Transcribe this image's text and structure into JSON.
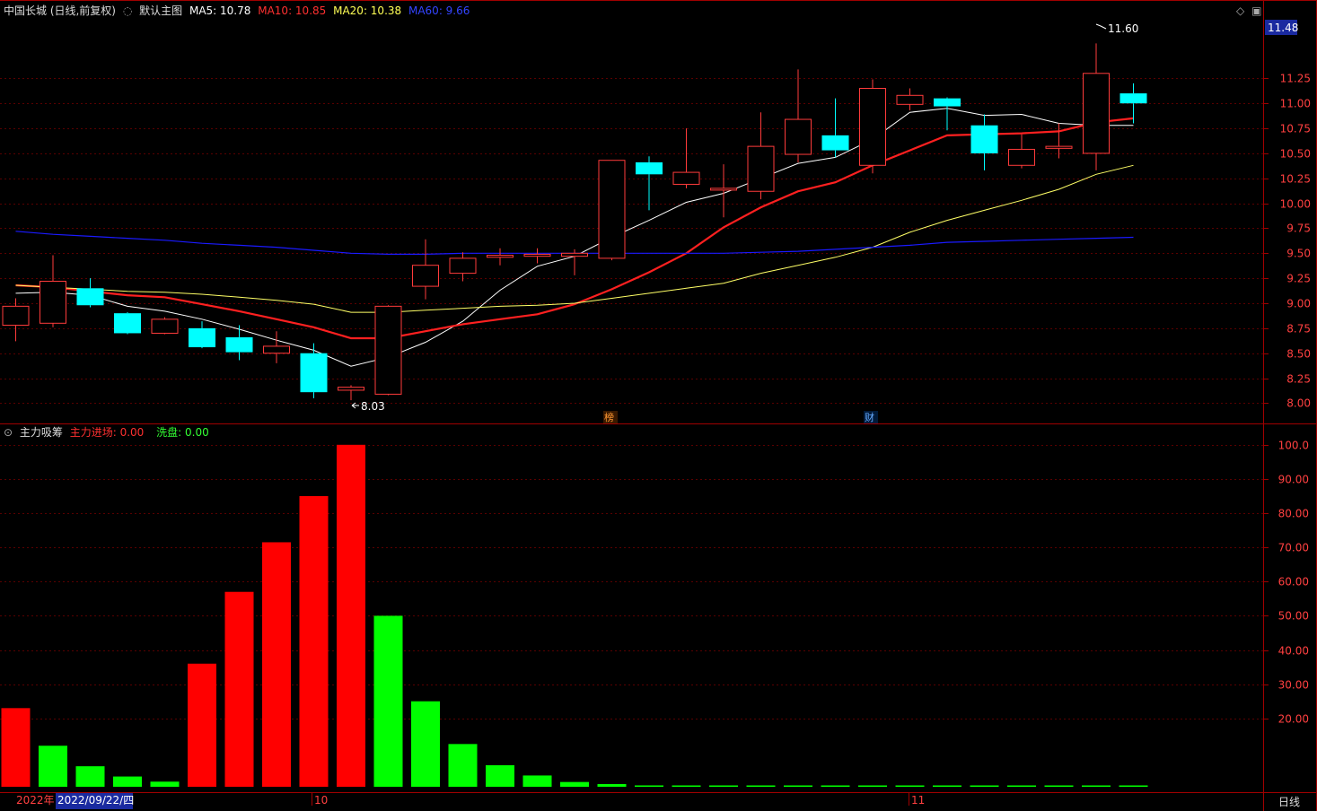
{
  "header": {
    "stock_label": "中国长城 (日线,前复权)",
    "template_label": "默认主图",
    "ma5": "MA5: 10.78",
    "ma10": "MA10: 10.85",
    "ma20": "MA20: 10.38",
    "ma60": "MA60: 9.66"
  },
  "sub_header": {
    "indicator_name": "主力吸筹",
    "in_label": "主力进场: 0.00",
    "wash_label": "洗盘: 0.00"
  },
  "colors": {
    "up": "#ff3b3b",
    "down": "#00ffff",
    "ma5": "#ffffff",
    "ma10": "#ff2020",
    "ma20": "#ffff66",
    "ma60": "#1a1aff",
    "bar_red": "#ff0000",
    "bar_green": "#00ff00",
    "axis": "#a00000"
  },
  "annotations": {
    "low_label": "8.03",
    "high_label": "11.60",
    "current_price": "11.48",
    "marker_bang": "榜",
    "marker_cai": "财"
  },
  "footer": {
    "year_label": "2022年",
    "date_label": "2022/09/22/四",
    "month_oct": "10",
    "month_nov": "11",
    "period_label": "日线"
  },
  "chart_data": [
    {
      "type": "candlestick",
      "y_ticks": [
        "11.25",
        "11.00",
        "10.75",
        "10.50",
        "10.25",
        "10.00",
        "9.75",
        "9.50",
        "9.25",
        "9.00",
        "8.75",
        "8.50",
        "8.25",
        "8.00"
      ],
      "ylim": [
        7.95,
        11.72
      ],
      "candles": [
        {
          "o": 8.78,
          "c": 8.97,
          "h": 9.05,
          "l": 8.62
        },
        {
          "o": 8.8,
          "c": 9.22,
          "h": 9.48,
          "l": 8.76
        },
        {
          "o": 9.15,
          "c": 8.98,
          "h": 9.25,
          "l": 8.96
        },
        {
          "o": 8.9,
          "c": 8.7,
          "h": 8.91,
          "l": 8.69
        },
        {
          "o": 8.7,
          "c": 8.84,
          "h": 8.86,
          "l": 8.69
        },
        {
          "o": 8.75,
          "c": 8.56,
          "h": 8.82,
          "l": 8.55
        },
        {
          "o": 8.66,
          "c": 8.51,
          "h": 8.78,
          "l": 8.43
        },
        {
          "o": 8.5,
          "c": 8.57,
          "h": 8.72,
          "l": 8.4
        },
        {
          "o": 8.5,
          "c": 8.11,
          "h": 8.6,
          "l": 8.05
        },
        {
          "o": 8.13,
          "c": 8.16,
          "h": 8.18,
          "l": 8.03
        },
        {
          "o": 8.09,
          "c": 8.97,
          "h": 8.98,
          "l": 8.08
        },
        {
          "o": 9.17,
          "c": 9.38,
          "h": 9.64,
          "l": 9.04
        },
        {
          "o": 9.3,
          "c": 9.45,
          "h": 9.51,
          "l": 9.22
        },
        {
          "o": 9.46,
          "c": 9.48,
          "h": 9.55,
          "l": 9.38
        },
        {
          "o": 9.47,
          "c": 9.49,
          "h": 9.55,
          "l": 9.4
        },
        {
          "o": 9.47,
          "c": 9.5,
          "h": 9.54,
          "l": 9.28
        },
        {
          "o": 9.45,
          "c": 10.43,
          "h": 10.43,
          "l": 9.43
        },
        {
          "o": 10.41,
          "c": 10.29,
          "h": 10.47,
          "l": 9.93
        },
        {
          "o": 10.19,
          "c": 10.31,
          "h": 10.75,
          "l": 10.15
        },
        {
          "o": 10.14,
          "c": 10.15,
          "h": 10.39,
          "l": 9.86
        },
        {
          "o": 10.12,
          "c": 10.57,
          "h": 10.91,
          "l": 10.04
        },
        {
          "o": 10.49,
          "c": 10.84,
          "h": 11.34,
          "l": 10.41
        },
        {
          "o": 10.68,
          "c": 10.53,
          "h": 11.05,
          "l": 10.46
        },
        {
          "o": 10.38,
          "c": 11.15,
          "h": 11.24,
          "l": 10.3
        },
        {
          "o": 10.99,
          "c": 11.08,
          "h": 11.15,
          "l": 10.93
        },
        {
          "o": 11.05,
          "c": 10.97,
          "h": 11.06,
          "l": 10.73
        },
        {
          "o": 10.78,
          "c": 10.5,
          "h": 10.89,
          "l": 10.33
        },
        {
          "o": 10.38,
          "c": 10.54,
          "h": 10.69,
          "l": 10.35
        },
        {
          "o": 10.55,
          "c": 10.57,
          "h": 10.8,
          "l": 10.45
        },
        {
          "o": 10.5,
          "c": 11.3,
          "h": 11.6,
          "l": 10.33
        },
        {
          "o": 11.1,
          "c": 11.0,
          "h": 11.2,
          "l": 10.8
        }
      ],
      "series": [
        {
          "name": "MA5",
          "values": [
            9.1,
            9.11,
            9.08,
            8.97,
            8.92,
            8.84,
            8.74,
            8.63,
            8.53,
            8.37,
            8.46,
            8.61,
            8.82,
            9.13,
            9.37,
            9.47,
            9.66,
            9.83,
            10.01,
            10.1,
            10.25,
            10.4,
            10.46,
            10.64,
            10.91,
            10.95,
            10.88,
            10.89,
            10.8,
            10.78,
            10.78
          ]
        },
        {
          "name": "MA10",
          "values": [
            9.18,
            9.16,
            9.12,
            9.08,
            9.06,
            8.99,
            8.92,
            8.84,
            8.76,
            8.65,
            8.65,
            8.72,
            8.79,
            8.84,
            8.89,
            8.99,
            9.14,
            9.31,
            9.5,
            9.76,
            9.96,
            10.12,
            10.21,
            10.38,
            10.53,
            10.68,
            10.69,
            10.7,
            10.72,
            10.81,
            10.85
          ]
        },
        {
          "name": "MA20",
          "values": [
            9.18,
            9.16,
            9.14,
            9.12,
            9.11,
            9.09,
            9.06,
            9.03,
            8.99,
            8.91,
            8.91,
            8.93,
            8.95,
            8.97,
            8.98,
            9.0,
            9.05,
            9.1,
            9.15,
            9.2,
            9.3,
            9.38,
            9.46,
            9.56,
            9.71,
            9.83,
            9.93,
            10.03,
            10.14,
            10.29,
            10.38
          ]
        },
        {
          "name": "MA60",
          "values": [
            9.72,
            9.69,
            9.67,
            9.65,
            9.63,
            9.6,
            9.58,
            9.56,
            9.53,
            9.5,
            9.49,
            9.49,
            9.5,
            9.5,
            9.5,
            9.5,
            9.5,
            9.5,
            9.5,
            9.5,
            9.51,
            9.52,
            9.54,
            9.56,
            9.58,
            9.61,
            9.62,
            9.63,
            9.64,
            9.65,
            9.66
          ]
        }
      ]
    },
    {
      "type": "bar",
      "y_ticks": [
        "100.0",
        "90.00",
        "80.00",
        "70.00",
        "60.00",
        "50.00",
        "40.00",
        "30.00",
        "20.00"
      ],
      "ylim": [
        0,
        101
      ],
      "values": [
        23,
        12,
        6,
        3,
        1.5,
        36,
        57,
        71.5,
        85,
        100,
        50,
        25,
        12.5,
        6.3,
        3.3,
        1.4,
        0.8,
        0.4,
        0.3,
        0.3,
        0.3,
        0.3,
        0.3,
        0.3,
        0.3,
        0.3,
        0.3,
        0.3,
        0.3,
        0.3,
        0.3
      ],
      "colors": [
        "r",
        "g",
        "g",
        "g",
        "g",
        "r",
        "r",
        "r",
        "r",
        "r",
        "g",
        "g",
        "g",
        "g",
        "g",
        "g",
        "g",
        "g",
        "g",
        "g",
        "g",
        "g",
        "g",
        "g",
        "g",
        "g",
        "g",
        "g",
        "g",
        "g",
        "g"
      ]
    }
  ]
}
